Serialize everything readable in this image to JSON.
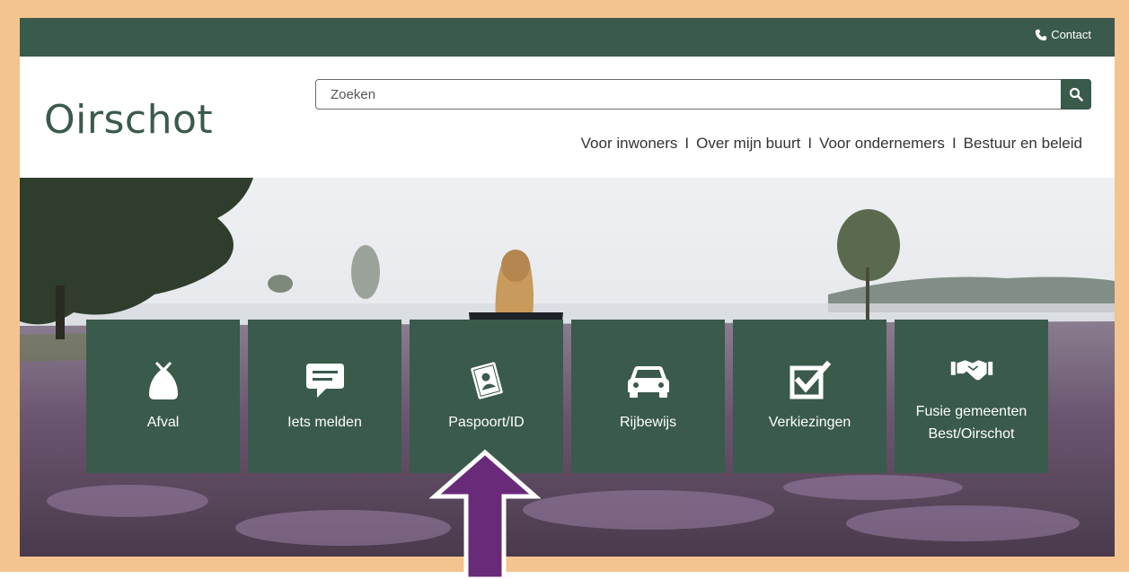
{
  "header": {
    "contact_label": "Contact",
    "logo_text": "Oirschot"
  },
  "search": {
    "placeholder": "Zoeken"
  },
  "nav": {
    "items": [
      {
        "label": "Voor inwoners"
      },
      {
        "label": "Over mijn buurt"
      },
      {
        "label": "Voor ondernemers"
      },
      {
        "label": "Bestuur en beleid"
      }
    ],
    "separator": "I"
  },
  "tiles": [
    {
      "label": "Afval",
      "icon": "waste-bag-icon"
    },
    {
      "label": "Iets melden",
      "icon": "message-icon"
    },
    {
      "label": "Paspoort/ID",
      "icon": "passport-icon"
    },
    {
      "label": "Rijbewijs",
      "icon": "car-icon"
    },
    {
      "label": "Verkiezingen",
      "icon": "ballot-check-icon"
    },
    {
      "label": "Fusie gemeenten\nBest/Oirschot",
      "icon": "handshake-icon"
    }
  ],
  "colors": {
    "brand_green": "#3a5a4b",
    "frame_orange": "#f3c48e",
    "arrow_purple": "#6a2a7a"
  }
}
